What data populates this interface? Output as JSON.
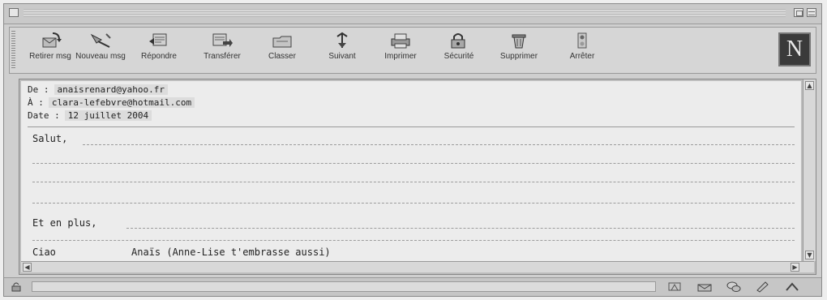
{
  "toolbar": {
    "buttons": [
      {
        "label": "Retirer msg",
        "icon": "get-mail-icon"
      },
      {
        "label": "Nouveau msg",
        "icon": "new-message-icon"
      },
      {
        "label": "Répondre",
        "icon": "reply-icon"
      },
      {
        "label": "Transférer",
        "icon": "forward-icon"
      },
      {
        "label": "Classer",
        "icon": "file-folder-icon"
      },
      {
        "label": "Suivant",
        "icon": "next-icon"
      },
      {
        "label": "Imprimer",
        "icon": "print-icon"
      },
      {
        "label": "Sécurité",
        "icon": "security-icon"
      },
      {
        "label": "Supprimer",
        "icon": "trash-icon"
      },
      {
        "label": "Arrêter",
        "icon": "stop-icon"
      }
    ],
    "logo_letter": "N"
  },
  "message": {
    "from_label": "De :",
    "from_value": "anaisrenard@yahoo.fr",
    "to_label": "À :",
    "to_value": "clara-lefebvre@hotmail.com",
    "date_label": "Date :",
    "date_value": "12 juillet 2004",
    "greeting": "Salut,",
    "more": "Et en plus,",
    "closing": "Ciao",
    "signature": "Anaïs (Anne-Lise t'embrasse aussi)"
  },
  "colors": {
    "window": "#cfcfcf",
    "pane": "#ececec",
    "logo_bg": "#3a3a3a"
  }
}
